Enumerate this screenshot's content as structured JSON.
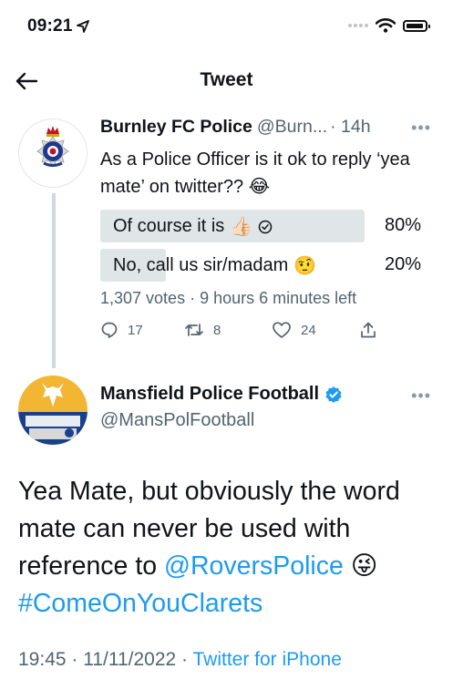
{
  "status_bar": {
    "time": "09:21"
  },
  "header": {
    "title": "Tweet"
  },
  "quoted_tweet": {
    "name": "Burnley FC Police",
    "handle": "@Burn...",
    "separator_time": "· 14h",
    "text": "As a Police Officer is it ok to reply ‘yea mate’ on twitter??",
    "text_emoji": "😂",
    "poll": {
      "options": [
        {
          "label": "Of course it is",
          "emoji": "👍🏻",
          "percent": "80%",
          "value": 0.8,
          "selected": true
        },
        {
          "label": "No, call us sir/madam",
          "emoji": "🤨",
          "percent": "20%",
          "value": 0.2,
          "selected": false
        }
      ],
      "meta": "1,307 votes · 9 hours 6 minutes left"
    },
    "actions": {
      "replies": "17",
      "retweets": "8",
      "likes": "24"
    }
  },
  "main_tweet": {
    "name": "Mansfield Police Football",
    "handle": "@MansPolFootball",
    "body_text": "Yea Mate, but obviously the word mate can never be used with reference to ",
    "mention": "@RoversPolice",
    "emoji": "😜",
    "hashtag": "#ComeOnYouClarets",
    "timestamp": "19:45 · 11/11/2022 · ",
    "source": "Twitter for iPhone"
  },
  "colors": {
    "link": "#1d9bf0",
    "secondary_text": "#536471",
    "poll_bar": "#e0e5e8",
    "verified": "#1d9bf0"
  }
}
